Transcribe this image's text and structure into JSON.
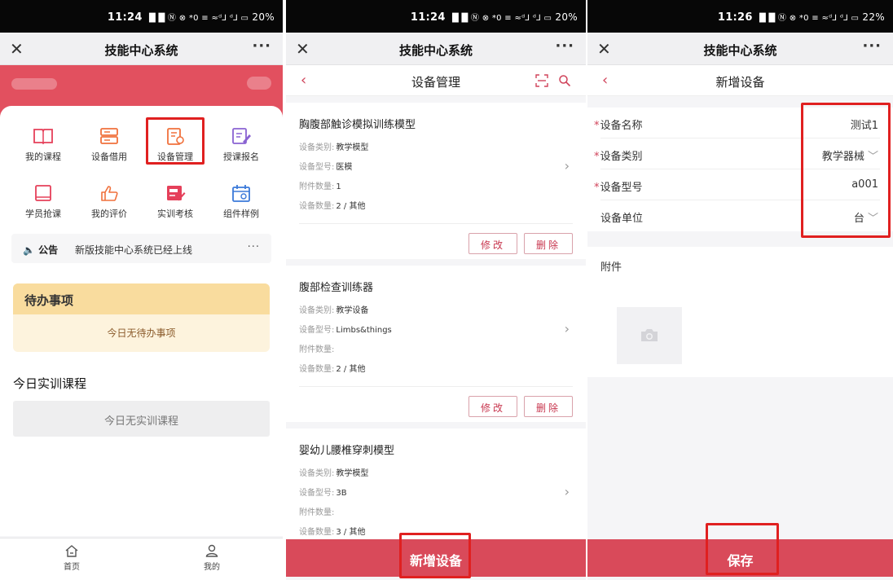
{
  "status_bars": [
    {
      "time": "11:24",
      "icons": "█ █  Ⓝ ⊗ *0 ≡ ≈ᵈ⅃ ᵈ⅃ ▭",
      "battery": "20%"
    },
    {
      "time": "11:24",
      "icons": "█ █  Ⓝ ⊗ *0 ≡ ≈ᵈ⅃ ᵈ⅃ ▭",
      "battery": "20%"
    },
    {
      "time": "11:26",
      "icons": "█ █  Ⓝ ⊗ *0 ≡ ≈ᵈ⅃ ᵈ⅃ ▭",
      "battery": "22%"
    }
  ],
  "app_title": "技能中心系统",
  "close_glyph": "✕",
  "more_glyph": "···",
  "home": {
    "grid": [
      {
        "label": "我的课程",
        "icon": "book-icon",
        "color": "#e5405a"
      },
      {
        "label": "设备借用",
        "icon": "server-icon",
        "color": "#f0713c"
      },
      {
        "label": "设备管理",
        "icon": "clipboard-icon",
        "color": "#f0713c"
      },
      {
        "label": "授课报名",
        "icon": "edit-icon",
        "color": "#8a63d2"
      },
      {
        "label": "学员抢课",
        "icon": "notebook-icon",
        "color": "#e5405a"
      },
      {
        "label": "我的评价",
        "icon": "thumbs-up-icon",
        "color": "#f0713c"
      },
      {
        "label": "实训考核",
        "icon": "exam-icon",
        "color": "#e5405a"
      },
      {
        "label": "组件样例",
        "icon": "calendar-icon",
        "color": "#3b79d9"
      }
    ],
    "notice_label": "公告",
    "notice_text": "新版技能中心系统已经上线",
    "notice_more": "···",
    "todo_title": "待办事项",
    "todo_empty": "今日无待办事项",
    "today_title": "今日实训课程",
    "today_empty": "今日无实训课程",
    "tabs": [
      {
        "label": "首页",
        "icon": "home-icon"
      },
      {
        "label": "我的",
        "icon": "user-icon"
      }
    ]
  },
  "device_list": {
    "title": "设备管理",
    "field_labels": {
      "category": "设备类别:",
      "model": "设备型号:",
      "attachments": "附件数量:",
      "quantity": "设备数量:"
    },
    "items": [
      {
        "name": "胸腹部触诊模拟训练模型",
        "category": "教学模型",
        "model": "医模",
        "attachments": "1",
        "quantity": "2 / 其他"
      },
      {
        "name": "腹部检查训练器",
        "category": "教学设备",
        "model": "Limbs&things",
        "attachments": "",
        "quantity": "2 / 其他"
      },
      {
        "name": "婴幼儿腰椎穿刺模型",
        "category": "教学模型",
        "model": "3B",
        "attachments": "",
        "quantity": "3 / 其他"
      }
    ],
    "edit_label": "修改",
    "delete_label": "删除",
    "add_label": "新增设备"
  },
  "add_device": {
    "title": "新增设备",
    "fields": [
      {
        "label": "设备名称",
        "required": true,
        "value": "测试1",
        "dropdown": false
      },
      {
        "label": "设备类别",
        "required": true,
        "value": "教学器械",
        "dropdown": true
      },
      {
        "label": "设备型号",
        "required": true,
        "value": "a001",
        "dropdown": false
      },
      {
        "label": "设备单位",
        "required": false,
        "value": "台",
        "dropdown": true
      }
    ],
    "required_mark": "*",
    "attachment_label": "附件",
    "save_label": "保存"
  },
  "colors": {
    "primary": "#d94a5a",
    "highlight": "#e02020",
    "banner": "#e2505f",
    "todo_header": "#f9dc9e",
    "todo_body": "#fdf3dd"
  }
}
